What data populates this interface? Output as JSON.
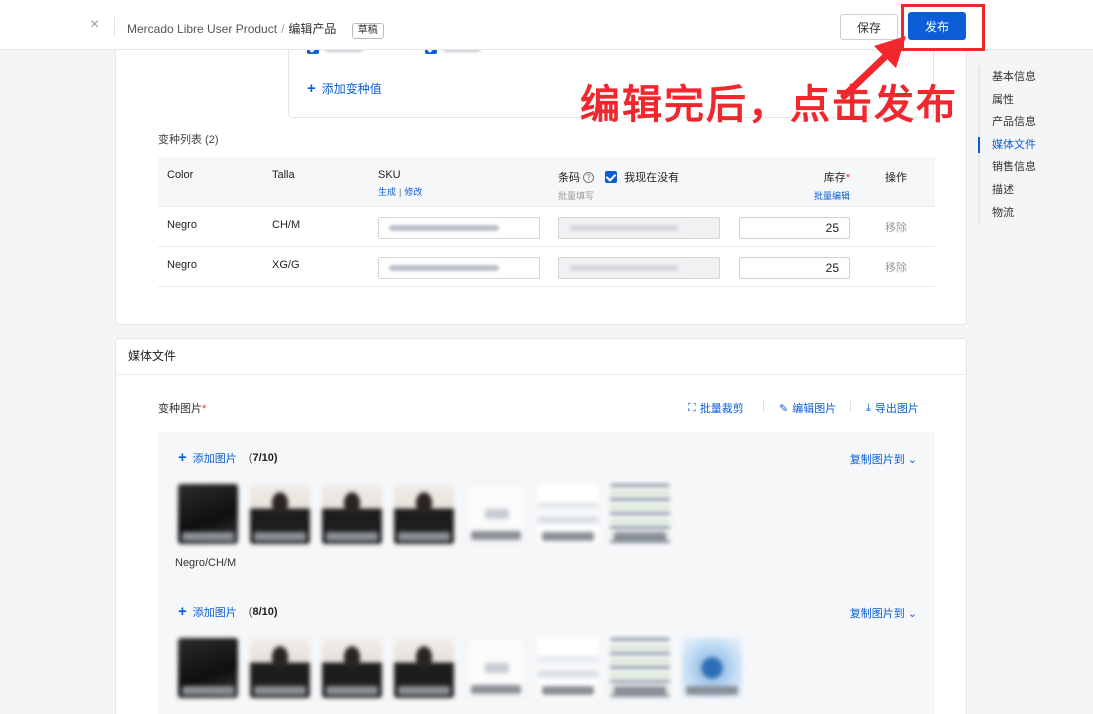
{
  "header": {
    "close_icon": "×",
    "breadcrumb_root": "Mercado Libre User Product",
    "breadcrumb_sep": "/",
    "breadcrumb_current": "编辑产品",
    "draft_badge": "草稿",
    "save_label": "保存",
    "publish_label": "发布"
  },
  "annotation": {
    "text": "编辑完后，点击发布",
    "color": "#f0282d"
  },
  "variant_values": {
    "add_label": "添加变种值"
  },
  "variant_list": {
    "title": "变种列表 (2)",
    "columns": {
      "color": "Color",
      "talla": "Talla",
      "sku": "SKU",
      "sku_generate": "生成",
      "sku_sep": "|",
      "sku_edit": "修改",
      "barcode": "条码",
      "barcode_help": "?",
      "barcode_batch": "批量填写",
      "no_barcode": "我现在没有",
      "stock": "库存",
      "stock_required": "*",
      "stock_batch": "批量编辑",
      "action": "操作"
    },
    "rows": [
      {
        "color": "Negro",
        "talla": "CH/M",
        "stock": "25",
        "action": "移除"
      },
      {
        "color": "Negro",
        "talla": "XG/G",
        "stock": "25",
        "action": "移除"
      }
    ]
  },
  "media": {
    "section_title": "媒体文件",
    "variant_images_title": "变种图片",
    "required_mark": "*",
    "tools": {
      "crop": "批量裁剪",
      "edit": "编辑图片",
      "export": "导出图片"
    },
    "groups": [
      {
        "add_label": "添加图片",
        "count_open": "(",
        "count": "7",
        "count_total": "/10)",
        "copy_label": "复制图片到",
        "variant_label": "Negro/CH/M"
      },
      {
        "add_label": "添加图片",
        "count_open": "(",
        "count": "8",
        "count_total": "/10)",
        "copy_label": "复制图片到",
        "variant_label": ""
      }
    ]
  },
  "sidenav": {
    "items": [
      {
        "label": "基本信息"
      },
      {
        "label": "属性"
      },
      {
        "label": "产品信息"
      },
      {
        "label": "媒体文件"
      },
      {
        "label": "销售信息"
      },
      {
        "label": "描述"
      },
      {
        "label": "物流"
      }
    ],
    "active": "媒体文件"
  },
  "colors": {
    "accent": "#0b5ed7",
    "annotation_red": "#f0282d"
  }
}
